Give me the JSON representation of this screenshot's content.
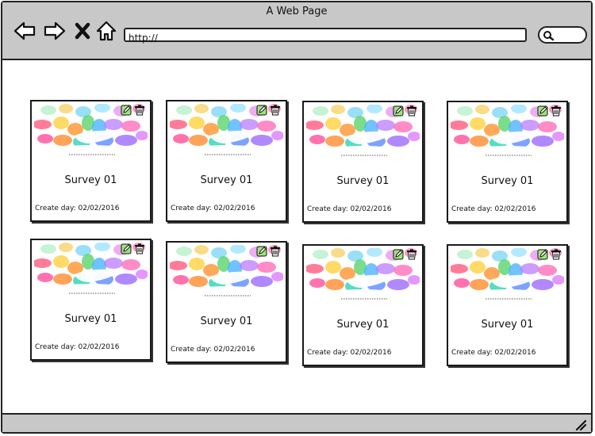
{
  "window": {
    "title": "A Web Page"
  },
  "addressbar": {
    "value": "http://"
  },
  "cards": [
    {
      "name": "Survey 01",
      "date_label": "Create day: 02/02/2016"
    },
    {
      "name": "Survey 01",
      "date_label": "Create day: 02/02/2016"
    },
    {
      "name": "Survey 01",
      "date_label": "Create day: 02/02/2016"
    },
    {
      "name": "Survey 01",
      "date_label": "Create day: 02/02/2016"
    },
    {
      "name": "Survey 01",
      "date_label": "Create day: 02/02/2016"
    },
    {
      "name": "Survey 01",
      "date_label": "Create day: 02/02/2016"
    },
    {
      "name": "Survey 01",
      "date_label": "Create day: 02/02/2016"
    },
    {
      "name": "Survey 01",
      "date_label": "Create day: 02/02/2016"
    }
  ],
  "icons": {
    "back": "arrow-left-icon",
    "forward": "arrow-right-icon",
    "stop": "close-icon",
    "home": "home-icon",
    "search": "search-icon",
    "edit": "edit-icon",
    "delete": "trash-icon"
  }
}
